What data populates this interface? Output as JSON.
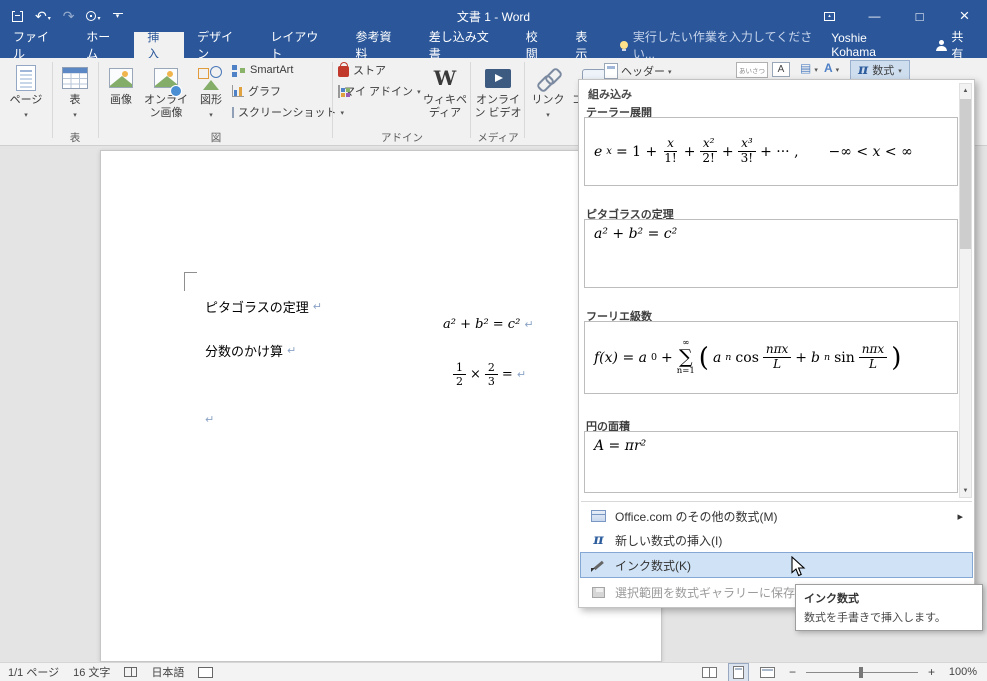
{
  "titlebar": {
    "title": "文書 1 - Word"
  },
  "tabs": {
    "file": "ファイル",
    "home": "ホーム",
    "insert": "挿入",
    "design": "デザイン",
    "layout": "レイアウト",
    "references": "参考資料",
    "mailings": "差し込み文書",
    "review": "校閲",
    "view": "表示",
    "tellme": "実行したい作業を入力してください...",
    "user": "Yoshie Kohama",
    "share": "共有"
  },
  "ribbon": {
    "pages": "ページ",
    "table": "表",
    "picture": "画像",
    "online_picture": "オンライン画像",
    "shapes": "図形",
    "smartart": "SmartArt",
    "chart": "グラフ",
    "screenshot": "スクリーンショット",
    "store": "ストア",
    "my_addins": "マイ アドイン",
    "wikipedia": "ウィキペディア",
    "online_video": "オンライン ビデオ",
    "links": "リンク",
    "comment": "コメント",
    "header": "ヘッダー",
    "greeting": "あいさつ",
    "textbox_letter": "A",
    "equation": "数式",
    "group_table": "表",
    "group_illustrations": "図",
    "group_addins": "アドイン",
    "group_media": "メディア"
  },
  "document": {
    "heading_pyth": "ピタゴラスの定理",
    "eq_pyth": "a² + b² = c²",
    "heading_frac": "分数のかけ算",
    "f1n": "1",
    "f1d": "2",
    "times": "×",
    "f2n": "2",
    "f2d": "3",
    "equals": "=",
    "mark": "↵"
  },
  "em": {
    "header": "組み込み",
    "taylor": {
      "title": "テーラー展開",
      "e": "e",
      "e_sup": "x",
      "eq": "= 1 +",
      "f1n": "x",
      "f1d": "1!",
      "plus": "+",
      "f2n": "x²",
      "f2d": "2!",
      "f3n": "x³",
      "f3d": "3!",
      "tail": "+ ··· ,",
      "range": "−∞ < x < ∞"
    },
    "pyth": {
      "title": "ピタゴラスの定理",
      "formula": "a² + b² = c²"
    },
    "fourier": {
      "title": "フーリエ級数",
      "lhs": "f(x) = a",
      "lhs_sub": "0",
      "plus": "+",
      "sigma": "∑",
      "top": "∞",
      "bot": "n=1",
      "open": "(",
      "a": "a",
      "a_sub": "n",
      "cos": "cos",
      "fn": "nπx",
      "fd": "L",
      "plus2": "+",
      "b": "b",
      "b_sub": "n",
      "sin": "sin",
      "close": ")"
    },
    "circle": {
      "title": "円の面積",
      "formula": "A = πr²"
    },
    "commands": [
      {
        "label": "Office.com のその他の数式(M)",
        "icon": "office-com-icon"
      },
      {
        "label": "新しい数式の挿入(I)",
        "icon": "pi-icon"
      },
      {
        "label": "インク数式(K)",
        "icon": "ink-pen-icon"
      },
      {
        "label": "選択範囲を数式ギャラリーに保存(S)...",
        "icon": "save-gallery-icon"
      }
    ],
    "tooltip": {
      "title": "インク数式",
      "body": "数式を手書きで挿入します。"
    }
  },
  "statusbar": {
    "page": "1/1 ページ",
    "words": "16 文字",
    "language": "日本語",
    "zoom_out": "−",
    "zoom_in": "+",
    "zoom": "100%"
  }
}
